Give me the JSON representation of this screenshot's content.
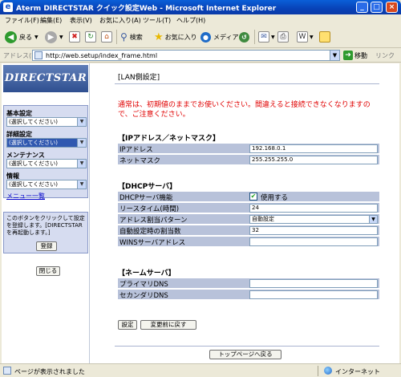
{
  "window": {
    "title": "Aterm DIRECTSTAR クイック設定Web - Microsoft Internet Explorer",
    "min_label": "_",
    "max_label": "□",
    "close_label": "×"
  },
  "menubar": {
    "items": [
      "ファイル(F)",
      "編集(E)",
      "表示(V)",
      "お気に入り(A)",
      "ツール(T)",
      "ヘルプ(H)"
    ]
  },
  "toolbar": {
    "back_label": "戻る",
    "search_label": "検索",
    "favorites_label": "お気に入り",
    "media_label": "メディア"
  },
  "addressbar": {
    "label": "アドレス(D)",
    "url": "http://web.setup/index_frame.html",
    "go_label": "移動",
    "links_label": "リンク"
  },
  "sidebar": {
    "logo_text": "DIRECTSTAR",
    "sections": [
      {
        "heading": "基本設定",
        "selected": "(選択してください)"
      },
      {
        "heading": "詳細設定",
        "selected": "(選択してください)"
      },
      {
        "heading": "メンテナンス",
        "selected": "(選択してください)"
      },
      {
        "heading": "情報",
        "selected": "(選択してください)"
      }
    ],
    "menu_list_label": "メニュー一覧",
    "info_text": "このボタンをクリックして設定を登録します。[DIRECTSTARを再起動します。]",
    "register_label": "登録",
    "close_label": "閉じる"
  },
  "main": {
    "page_title": "[LAN側設定]",
    "warning": "通常は、初期値のままでお使いください。間違えると接続できなくなりますので、ご注意ください。",
    "ip_section": {
      "heading": "【IPアドレス／ネットマスク】",
      "rows": [
        {
          "label": "IPアドレス",
          "value": "192.168.0.1"
        },
        {
          "label": "ネットマスク",
          "value": "255.255.255.0"
        }
      ]
    },
    "dhcp_section": {
      "heading": "【DHCPサーバ】",
      "function_label": "DHCPサーバ機能",
      "function_checkbox_label": "使用する",
      "lease_label": "リースタイム(時間)",
      "lease_value": "24",
      "pattern_label": "アドレス割当パターン",
      "pattern_value": "自動設定",
      "count_label": "自動設定時の割当数",
      "count_value": "32",
      "wins_label": "WINSサーバアドレス",
      "wins_value": ""
    },
    "dns_section": {
      "heading": "【ネームサーバ】",
      "rows": [
        {
          "label": "プライマリDNS",
          "value": ""
        },
        {
          "label": "セカンダリDNS",
          "value": ""
        }
      ]
    },
    "set_label": "設定",
    "revert_label": "変更前に戻す",
    "top_page_label": "トップページへ戻る"
  },
  "statusbar": {
    "text": "ページが表示されました",
    "zone": "インターネット"
  }
}
